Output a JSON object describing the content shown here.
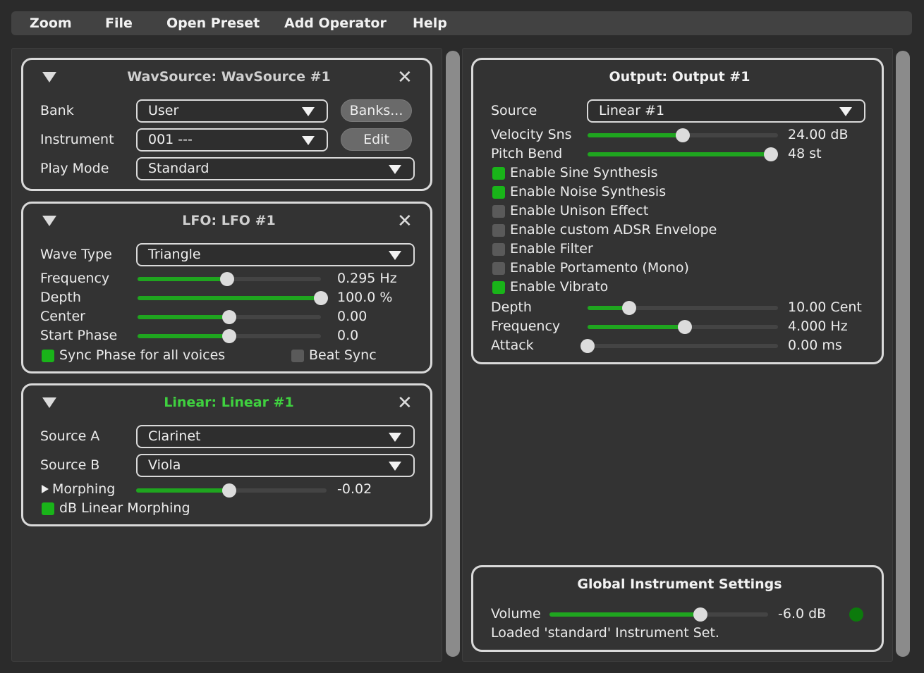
{
  "menu": {
    "zoom": "Zoom",
    "file": "File",
    "open_preset": "Open Preset",
    "add_operator": "Add Operator",
    "help": "Help"
  },
  "wavsource": {
    "title": "WavSource: WavSource #1",
    "bank_label": "Bank",
    "bank_value": "User",
    "banks_button": "Banks...",
    "instrument_label": "Instrument",
    "instrument_value": "001 ---",
    "edit_button": "Edit",
    "playmode_label": "Play Mode",
    "playmode_value": "Standard"
  },
  "lfo": {
    "title": "LFO: LFO #1",
    "wavetype_label": "Wave Type",
    "wavetype_value": "Triangle",
    "sliders": [
      {
        "label": "Frequency",
        "value": "0.295 Hz",
        "level": 0.49
      },
      {
        "label": "Depth",
        "value": "100.0 %",
        "level": 1.0
      },
      {
        "label": "Center",
        "value": "0.00",
        "level": 0.5
      },
      {
        "label": "Start Phase",
        "value": "0.0",
        "level": 0.5
      }
    ],
    "sync_phase": {
      "label": "Sync Phase for all voices",
      "checked": true
    },
    "beat_sync": {
      "label": "Beat Sync",
      "checked": false
    }
  },
  "linear": {
    "title": "Linear: Linear #1",
    "title_color": "#3fd13f",
    "source_a_label": "Source A",
    "source_a_value": "Clarinet",
    "source_b_label": "Source B",
    "source_b_value": "Viola",
    "morphing_label": "Morphing",
    "morphing_value": "-0.02",
    "morphing_level": 0.49,
    "db_linear": {
      "label": "dB Linear Morphing",
      "checked": true
    }
  },
  "output": {
    "title": "Output: Output #1",
    "source_label": "Source",
    "source_value": "Linear #1",
    "velocity": {
      "label": "Velocity Sns",
      "value": "24.00 dB",
      "level": 0.5
    },
    "pitch_bend": {
      "label": "Pitch Bend",
      "value": "48 st",
      "level": 1.0
    },
    "checkboxes": [
      {
        "label": "Enable Sine Synthesis",
        "checked": true
      },
      {
        "label": "Enable Noise Synthesis",
        "checked": true
      },
      {
        "label": "Enable Unison Effect",
        "checked": false
      },
      {
        "label": "Enable custom ADSR Envelope",
        "checked": false
      },
      {
        "label": "Enable Filter",
        "checked": false
      },
      {
        "label": "Enable Portamento (Mono)",
        "checked": false
      },
      {
        "label": "Enable Vibrato",
        "checked": true
      }
    ],
    "vibrato_sliders": [
      {
        "label": "Depth",
        "value": "10.00 Cent",
        "level": 0.22
      },
      {
        "label": "Frequency",
        "value": "4.000 Hz",
        "level": 0.51
      },
      {
        "label": "Attack",
        "value": "0.00 ms",
        "level": 0.0
      }
    ]
  },
  "global": {
    "title": "Global Instrument Settings",
    "volume_label": "Volume",
    "volume_value": "-6.0 dB",
    "volume_level": 0.69,
    "status": "Loaded 'standard' Instrument Set."
  },
  "colors": {
    "accent_green": "#1fa51f",
    "check_on": "#19b419",
    "check_off": "#5a5a5a",
    "led": "#0c7a0c"
  }
}
